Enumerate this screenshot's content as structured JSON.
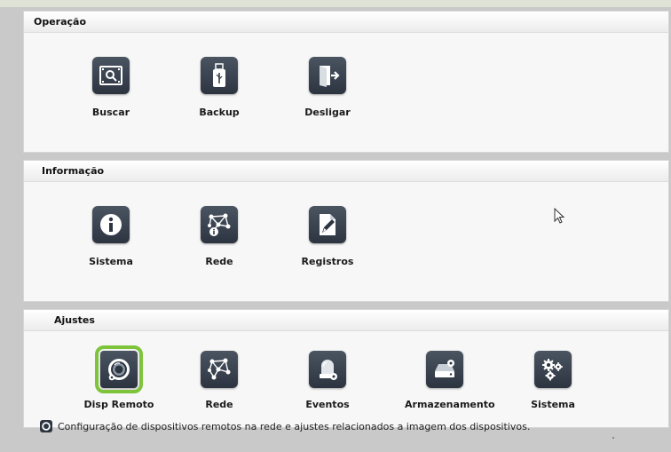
{
  "sections": [
    {
      "title": "Operação",
      "items": [
        {
          "label": "Buscar",
          "icon": "search-film-icon"
        },
        {
          "label": "Backup",
          "icon": "usb-drive-icon"
        },
        {
          "label": "Desligar",
          "icon": "exit-door-icon"
        }
      ]
    },
    {
      "title": "Informação",
      "items": [
        {
          "label": "Sistema",
          "icon": "info-icon"
        },
        {
          "label": "Rede",
          "icon": "network-info-icon"
        },
        {
          "label": "Registros",
          "icon": "log-pencil-icon"
        }
      ]
    },
    {
      "title": "Ajustes",
      "items": [
        {
          "label": "Disp Remoto",
          "icon": "remote-camera-icon",
          "selected": true
        },
        {
          "label": "Rede",
          "icon": "network-icon"
        },
        {
          "label": "Eventos",
          "icon": "alarm-light-icon"
        },
        {
          "label": "Armazenamento",
          "icon": "hard-drive-icon"
        },
        {
          "label": "Sistema",
          "icon": "gears-icon"
        }
      ]
    }
  ],
  "status": {
    "icon": "remote-camera-icon",
    "text": "Configuração de dispositivos remotos na rede e ajustes relacionados a imagem dos dispositivos."
  },
  "colors": {
    "selected_outline": "#7dc43a",
    "tile_background": "#2c3440",
    "panel_background": "#f7f7f7",
    "page_background": "#c9c9c9"
  }
}
